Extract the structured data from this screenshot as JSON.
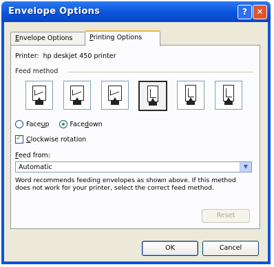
{
  "window": {
    "title": "Envelope Options",
    "help_glyph": "?",
    "close_glyph": "✕"
  },
  "tabs": [
    {
      "prefix": "",
      "accel": "E",
      "rest": "nvelope Options",
      "selected": false
    },
    {
      "prefix": "",
      "accel": "P",
      "rest": "rinting Options",
      "selected": true
    }
  ],
  "printer": {
    "label": "Printer:",
    "value": "hp deskjet 450 printer"
  },
  "feed_method": {
    "label": "Feed method",
    "icons": [
      {
        "name": "feed-horizontal-left-icon",
        "selected": false
      },
      {
        "name": "feed-horizontal-center-icon",
        "selected": false
      },
      {
        "name": "feed-horizontal-right-icon",
        "selected": false
      },
      {
        "name": "feed-rotated-left-icon",
        "selected": true
      },
      {
        "name": "feed-rotated-center-icon",
        "selected": false
      },
      {
        "name": "feed-rotated-right-icon",
        "selected": false
      }
    ],
    "face_up": {
      "prefix": "Face ",
      "accel": "u",
      "rest": "p",
      "checked": false
    },
    "face_down": {
      "prefix": "Face ",
      "accel": "d",
      "rest": "own",
      "checked": true
    }
  },
  "clockwise": {
    "prefix": "",
    "accel": "C",
    "rest": "lockwise rotation",
    "checked": true
  },
  "feed_from": {
    "prefix": "",
    "accel": "F",
    "rest": "eed from:",
    "value": "Automatic",
    "dropdown_glyph": "▼"
  },
  "info_text": "Word recommends feeding envelopes as shown above. If this method does not work for your printer, select the correct feed method.",
  "buttons": {
    "reset": "Reset",
    "ok": "OK",
    "cancel": "Cancel"
  },
  "colors": {
    "title_bar": "#0b54dc",
    "dialog_face": "#ece9d8",
    "check_green": "#21a121"
  }
}
